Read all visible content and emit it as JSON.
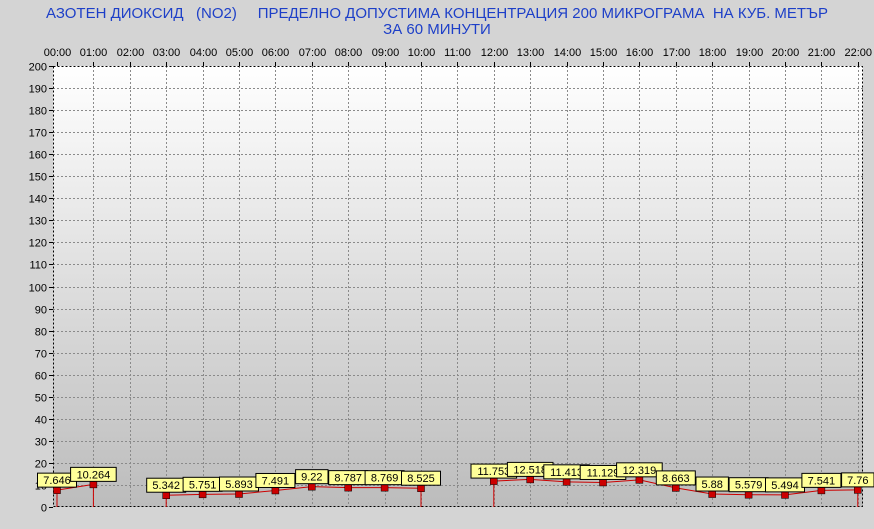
{
  "chart_data": {
    "type": "line",
    "title_lines": [
      "АЗОТЕН ДИОКСИД   (NO2)     ПРЕДЕЛНО ДОПУСТИМА КОНЦЕНТРАЦИЯ 200 МИКРОГРАМА  НА КУБ. МЕТЪР",
      "ЗА 60 МИНУТИ"
    ],
    "xlabel": "",
    "ylabel": "",
    "ylim": [
      0,
      200
    ],
    "y_ticks": [
      0,
      10,
      20,
      30,
      40,
      50,
      60,
      70,
      80,
      90,
      100,
      110,
      120,
      130,
      140,
      150,
      160,
      170,
      180,
      190,
      200
    ],
    "x_ticks": [
      "00:00",
      "01:00",
      "02:00",
      "03:00",
      "04:00",
      "05:00",
      "06:00",
      "07:00",
      "08:00",
      "09:00",
      "10:00",
      "11:00",
      "12:00",
      "13:00",
      "14:00",
      "15:00",
      "16:00",
      "17:00",
      "18:00",
      "19:00",
      "20:00",
      "21:00",
      "22:00"
    ],
    "grid": true,
    "series": [
      {
        "points": [
          {
            "x": "00:00",
            "y": 7.646,
            "label": "7.646"
          },
          {
            "x": "01:00",
            "y": 10.264,
            "label": "10.264"
          },
          {
            "x": "03:00",
            "y": 5.342,
            "label": "5.342"
          },
          {
            "x": "04:00",
            "y": 5.751,
            "label": "5.751"
          },
          {
            "x": "05:00",
            "y": 5.893,
            "label": "5.893"
          },
          {
            "x": "06:00",
            "y": 7.491,
            "label": "7.491"
          },
          {
            "x": "07:00",
            "y": 9.22,
            "label": "9.22"
          },
          {
            "x": "08:00",
            "y": 8.787,
            "label": "8.787"
          },
          {
            "x": "09:00",
            "y": 8.769,
            "label": "8.769"
          },
          {
            "x": "10:00",
            "y": 8.525,
            "label": "8.525"
          },
          {
            "x": "12:00",
            "y": 11.753,
            "label": "11.753"
          },
          {
            "x": "13:00",
            "y": 12.518,
            "label": "12.518"
          },
          {
            "x": "14:00",
            "y": 11.413,
            "label": "11.413"
          },
          {
            "x": "15:00",
            "y": 11.129,
            "label": "11.129"
          },
          {
            "x": "16:00",
            "y": 12.319,
            "label": "12.319"
          },
          {
            "x": "17:00",
            "y": 8.663,
            "label": "8.663"
          },
          {
            "x": "18:00",
            "y": 5.88,
            "label": "5.88"
          },
          {
            "x": "19:00",
            "y": 5.579,
            "label": "5.579"
          },
          {
            "x": "20:00",
            "y": 5.494,
            "label": "5.494"
          },
          {
            "x": "21:00",
            "y": 7.541,
            "label": "7.541"
          },
          {
            "x": "22:00",
            "y": 7.76,
            "label": "7.76"
          }
        ]
      }
    ],
    "colors": {
      "title": "#1d3fc8",
      "background": "#d4d4d4",
      "plot_top": "#ffffff",
      "plot_bottom": "#bcbcbc",
      "grid": "#8a8a8a",
      "line": "#cc0000",
      "marker": "#cc0000",
      "label_bg": "#ffff99"
    }
  }
}
